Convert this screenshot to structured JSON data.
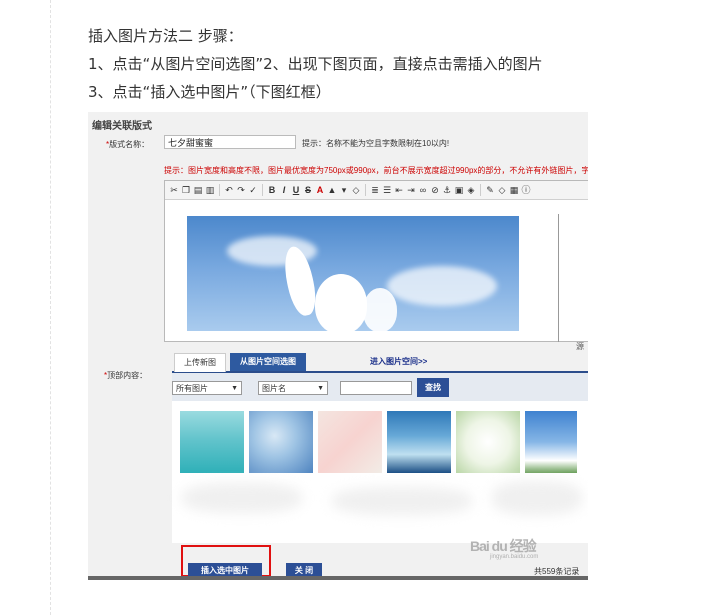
{
  "article": {
    "line1": "插入图片方法二 步骤：",
    "line2": "1、点击“从图片空间选图”2、出现下图页面，直接点击需插入的图片",
    "line3": "3、点击“插入选中图片”（下图红框）"
  },
  "editor": {
    "section_title": "编辑关联版式",
    "name_label": "版式名称：",
    "name_value": "七夕甜蜜蜜",
    "name_hint": "提示：名称不能为空且字数限制在10以内!",
    "tip": "提示：图片宽度和高度不限，图片最优宽度为750px或990px，前台不展示宽度超过990px的部分，不允许有外链图片，字数",
    "status_mark": "源"
  },
  "picker": {
    "content_label": "顶部内容：",
    "tab_upload": "上传新图",
    "tab_space": "从图片空间选图",
    "enter_space": "进入图片空间>>",
    "filter_all": "所有图片",
    "filter_name": "图片名",
    "search_button": "查找",
    "insert_button": "插入选中图片",
    "close_button": "关 闭",
    "total": "共559条记录"
  },
  "watermark": {
    "brand": "Bai du 经验",
    "url": "jingyan.baidu.com"
  },
  "colors": {
    "accent": "#2c4f96",
    "highlight": "#e01010",
    "warning": "#cc0000"
  }
}
